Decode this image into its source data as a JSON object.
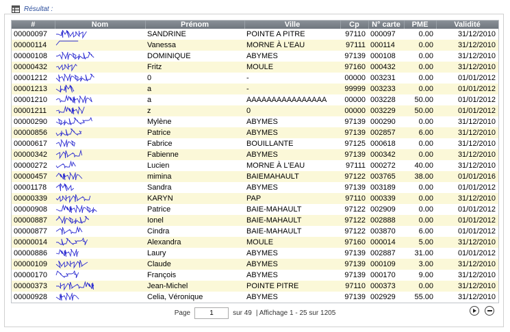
{
  "panel": {
    "title": "Résultat :"
  },
  "table": {
    "columns": [
      "#",
      "Nom",
      "Prénom",
      "Ville",
      "Cp",
      "N° carte",
      "PME",
      "Validité"
    ],
    "rows": [
      [
        "00000097",
        "",
        "SANDRINE",
        "POINTE A PITRE",
        "97110",
        "000097",
        "0.00",
        "31/12/2010"
      ],
      [
        "00000114",
        "",
        "Vanessa",
        "MORNE À L'EAU",
        "97111",
        "000114",
        "0.00",
        "31/12/2010"
      ],
      [
        "00000108",
        "",
        "DOMINIQUE",
        "ABYMES",
        "97139",
        "000108",
        "0.00",
        "31/12/2010"
      ],
      [
        "00000432",
        "",
        "Fritz",
        "MOULE",
        "97160",
        "000432",
        "0.00",
        "31/12/2010"
      ],
      [
        "00001212",
        "",
        "0",
        "-",
        "00000",
        "003231",
        "0.00",
        "01/01/2012"
      ],
      [
        "00001213",
        "",
        "a",
        "-",
        "99999",
        "003233",
        "0.00",
        "01/01/2012"
      ],
      [
        "00001210",
        "",
        "a",
        "AAAAAAAAAAAAAAAA",
        "00000",
        "003228",
        "50.00",
        "01/01/2012"
      ],
      [
        "00001211",
        "",
        "z",
        "0",
        "00000",
        "003229",
        "50.00",
        "01/01/2012"
      ],
      [
        "00000290",
        "",
        "Mylène",
        "ABYMES",
        "97139",
        "000290",
        "0.00",
        "31/12/2010"
      ],
      [
        "00000856",
        "",
        "Patrice",
        "ABYMES",
        "97139",
        "002857",
        "6.00",
        "31/12/2010"
      ],
      [
        "00000617",
        "",
        "Fabrice",
        "BOUILLANTE",
        "97125",
        "000618",
        "0.00",
        "31/12/2010"
      ],
      [
        "00000342",
        "",
        "Fabienne",
        "ABYMES",
        "97139",
        "000342",
        "0.00",
        "31/12/2010"
      ],
      [
        "00000272",
        "",
        "Lucien",
        "MORNE À L'EAU",
        "97111",
        "000272",
        "40.00",
        "31/12/2010"
      ],
      [
        "00000457",
        "",
        "mimina",
        "BAIEMAHAULT",
        "97122",
        "003765",
        "38.00",
        "01/01/2016"
      ],
      [
        "00001178",
        "",
        "Sandra",
        "ABYMES",
        "97139",
        "003189",
        "0.00",
        "01/01/2012"
      ],
      [
        "00000339",
        "",
        "KARYN",
        "PAP",
        "97110",
        "000339",
        "0.00",
        "31/12/2010"
      ],
      [
        "00000908",
        "",
        "Patrice",
        "BAIE-MAHAULT",
        "97122",
        "002909",
        "0.00",
        "01/01/2012"
      ],
      [
        "00000887",
        "",
        "Ionel",
        "BAIE-MAHAULT",
        "97122",
        "002888",
        "0.00",
        "01/01/2012"
      ],
      [
        "00000877",
        "",
        "Cindra",
        "BAIE-MAHAULT",
        "97122",
        "003870",
        "6.00",
        "01/01/2012"
      ],
      [
        "00000014",
        "",
        "Alexandra",
        "MOULE",
        "97160",
        "000014",
        "5.00",
        "31/12/2010"
      ],
      [
        "00000886",
        "",
        "Laury",
        "ABYMES",
        "97139",
        "002887",
        "31.00",
        "01/01/2012"
      ],
      [
        "00000109",
        "",
        "Claude",
        "ABYMES",
        "97139",
        "000109",
        "3.00",
        "31/12/2010"
      ],
      [
        "00000170",
        "",
        "François",
        "ABYMES",
        "97139",
        "000170",
        "9.00",
        "31/12/2010"
      ],
      [
        "00000373",
        "",
        "Jean-Michel",
        "POINTE PITRE",
        "97110",
        "000373",
        "0.00",
        "31/12/2010"
      ],
      [
        "00000928",
        "",
        "Celia, Véronique",
        "ABYMES",
        "97139",
        "002929",
        "55.00",
        "31/12/2010"
      ]
    ]
  },
  "pager": {
    "page_label": "Page",
    "page_value": "1",
    "of_label": "sur 49",
    "display_text": "|   Affichage 1  - 25 sur 1205"
  },
  "icons": {
    "results": "table-icon",
    "next": "next-page-icon",
    "last": "last-page-icon"
  }
}
